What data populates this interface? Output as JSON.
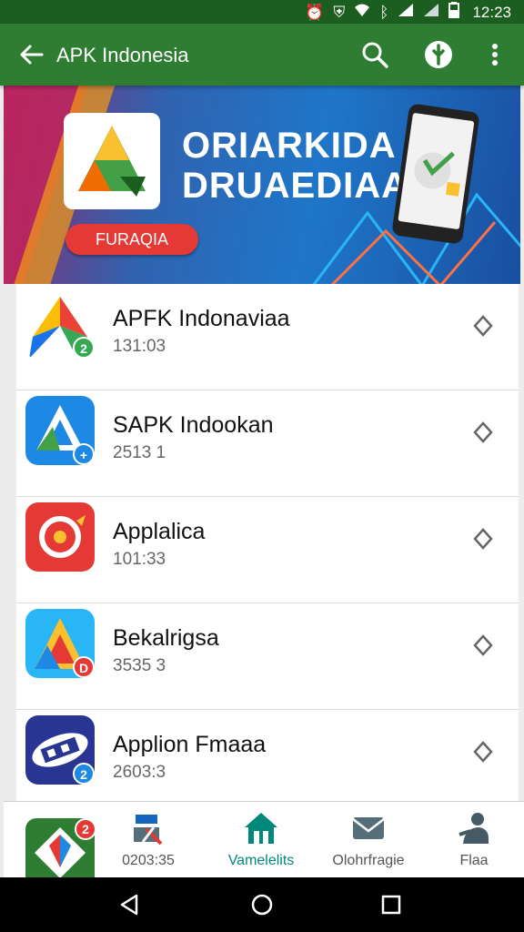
{
  "status_bar": {
    "time": "12:23",
    "icons": [
      "alarm-icon",
      "shield-status-icon",
      "wifi-icon",
      "bluetooth-icon",
      "signal-icon",
      "signal-icon",
      "battery-icon"
    ]
  },
  "app_bar": {
    "title": "APK Indonesia",
    "actions": [
      "search-icon",
      "shield-icon",
      "more-vert-icon"
    ]
  },
  "banner": {
    "headline_line1": "ORIARKIDA",
    "headline_line2": "DRUAEDIAA",
    "cta_label": "FURAQIA"
  },
  "apps": [
    {
      "name": "APFK Indonaviaa",
      "meta": "131:03",
      "badge": "2"
    },
    {
      "name": "SAPK Indookan",
      "meta": "2513 1",
      "badge": "+"
    },
    {
      "name": "Applalica",
      "meta": "101:33",
      "badge": ""
    },
    {
      "name": "Bekalrigsa",
      "meta": "3535 3",
      "badge": "D"
    },
    {
      "name": "Applion Fmaaa",
      "meta": "2603:3",
      "badge": "2"
    }
  ],
  "bottom_nav": {
    "items": [
      {
        "label": "0203:35",
        "icon": "tools-icon"
      },
      {
        "label": "Vamelelits",
        "icon": "home-icon",
        "active": true
      },
      {
        "label": "Olohrfragie",
        "icon": "mail-icon"
      },
      {
        "label": "Flaa",
        "icon": "person-icon"
      }
    ],
    "peek_badge": "2"
  },
  "colors": {
    "status_bar": "#1b5e20",
    "app_bar": "#2e7d32",
    "accent_active": "#00897b",
    "cta": "#e53935"
  }
}
